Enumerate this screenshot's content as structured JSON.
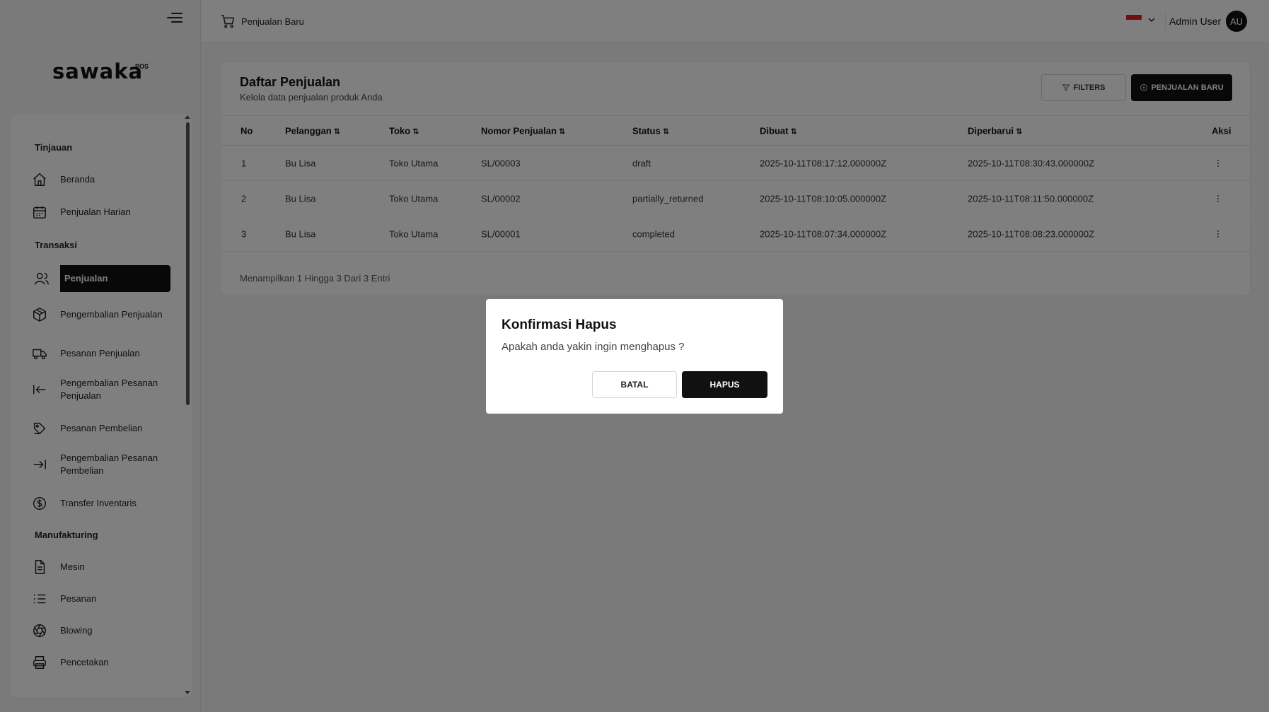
{
  "brand": {
    "logo_text": "sawaka",
    "logo_sup": "POS"
  },
  "topbar": {
    "page_label": "Penjualan Baru",
    "user_name": "Admin User",
    "avatar_initials": "AU",
    "language_flag": "id-flag-icon"
  },
  "sidebar": {
    "sections": [
      {
        "title": "Tinjauan"
      },
      {
        "title": "Transaksi"
      },
      {
        "title": "Manufakturing"
      }
    ],
    "items": [
      {
        "label": "Beranda",
        "icon": "home-icon"
      },
      {
        "label": "Penjualan Harian",
        "icon": "calendar-icon"
      },
      {
        "label": "Penjualan",
        "icon": "users-icon",
        "active": true
      },
      {
        "label": "Pengembalian Penjualan",
        "icon": "box-icon"
      },
      {
        "label": "Pesanan Penjualan",
        "icon": "truck-icon"
      },
      {
        "label": "Pengembalian Pesanan Penjualan",
        "icon": "arrow-left-bar-icon"
      },
      {
        "label": "Pesanan Pembelian",
        "icon": "tag-icon"
      },
      {
        "label": "Pengembalian Pesanan Pembelian",
        "icon": "arrow-right-bar-icon"
      },
      {
        "label": "Transfer Inventaris",
        "icon": "dollar-circle-icon"
      },
      {
        "label": "Mesin",
        "icon": "document-icon"
      },
      {
        "label": "Pesanan",
        "icon": "list-icon"
      },
      {
        "label": "Blowing",
        "icon": "aperture-icon"
      },
      {
        "label": "Pencetakan",
        "icon": "printer-icon"
      }
    ]
  },
  "card": {
    "title": "Daftar Penjualan",
    "subtitle": "Kelola data penjualan produk Anda",
    "filter_label": "FILTERS",
    "new_label": "PENJUALAN BARU",
    "footer": "Menampilkan 1 Hingga 3 Dari 3 Entri"
  },
  "table": {
    "columns": [
      "No",
      "Pelanggan",
      "Toko",
      "Nomor Penjualan",
      "Status",
      "Dibuat",
      "Diperbarui",
      "Aksi"
    ],
    "sort_glyph": "⇅",
    "rows": [
      [
        "1",
        "Bu Lisa",
        "Toko Utama",
        "SL/00003",
        "draft",
        "2025-10-11T08:17:12.000000Z",
        "2025-10-11T08:30:43.000000Z"
      ],
      [
        "2",
        "Bu Lisa",
        "Toko Utama",
        "SL/00002",
        "partially_returned",
        "2025-10-11T08:10:05.000000Z",
        "2025-10-11T08:11:50.000000Z"
      ],
      [
        "3",
        "Bu Lisa",
        "Toko Utama",
        "SL/00001",
        "completed",
        "2025-10-11T08:07:34.000000Z",
        "2025-10-11T08:08:23.000000Z"
      ]
    ]
  },
  "modal": {
    "title": "Konfirmasi Hapus",
    "message": "Apakah anda yakin ingin menghapus ?",
    "cancel_label": "BATAL",
    "confirm_label": "HAPUS"
  }
}
